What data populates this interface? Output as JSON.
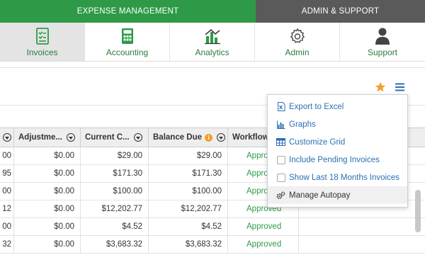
{
  "topbar": {
    "expense": "EXPENSE MANAGEMENT",
    "admin": "ADMIN & SUPPORT"
  },
  "nav": {
    "items": [
      {
        "label": "Invoices",
        "icon": "invoice-checklist-icon"
      },
      {
        "label": "Accounting",
        "icon": "calculator-icon"
      },
      {
        "label": "Analytics",
        "icon": "bar-chart-icon"
      },
      {
        "label": "Admin",
        "icon": "gear-icon"
      },
      {
        "label": "Support",
        "icon": "person-icon"
      }
    ]
  },
  "toolbar": {
    "favorite_icon": "star-icon",
    "menu_icon": "hamburger-icon",
    "star_color": "#f0a030"
  },
  "grid": {
    "headers": {
      "adjustments": "Adjustme...",
      "current_charges": "Current C...",
      "balance_due": "Balance Due",
      "workflow": "Workflow"
    },
    "rows": [
      {
        "prev": "00",
        "adjustment": "$0.00",
        "current": "$29.00",
        "balance": "$29.00",
        "status": "Approv"
      },
      {
        "prev": "95",
        "adjustment": "$0.00",
        "current": "$171.30",
        "balance": "$171.30",
        "status": "Approv"
      },
      {
        "prev": "00",
        "adjustment": "$0.00",
        "current": "$100.00",
        "balance": "$100.00",
        "status": "Approv"
      },
      {
        "prev": "12",
        "adjustment": "$0.00",
        "current": "$12,202.77",
        "balance": "$12,202.77",
        "status": "Approved"
      },
      {
        "prev": "00",
        "adjustment": "$0.00",
        "current": "$4.52",
        "balance": "$4.52",
        "status": "Approved"
      },
      {
        "prev": "32",
        "adjustment": "$0.00",
        "current": "$3,683.32",
        "balance": "$3,683.32",
        "status": "Approved"
      }
    ]
  },
  "menu": {
    "items": [
      {
        "label": "Export to Excel",
        "icon": "excel-file-icon"
      },
      {
        "label": "Graphs",
        "icon": "bar-chart-icon"
      },
      {
        "label": "Customize Grid",
        "icon": "grid-icon"
      },
      {
        "label": "Include Pending Invoices",
        "icon": "checkbox-icon"
      },
      {
        "label": "Show Last 18 Months Invoices",
        "icon": "checkbox-icon"
      },
      {
        "label": "Manage Autopay",
        "icon": "gears-icon"
      }
    ]
  }
}
